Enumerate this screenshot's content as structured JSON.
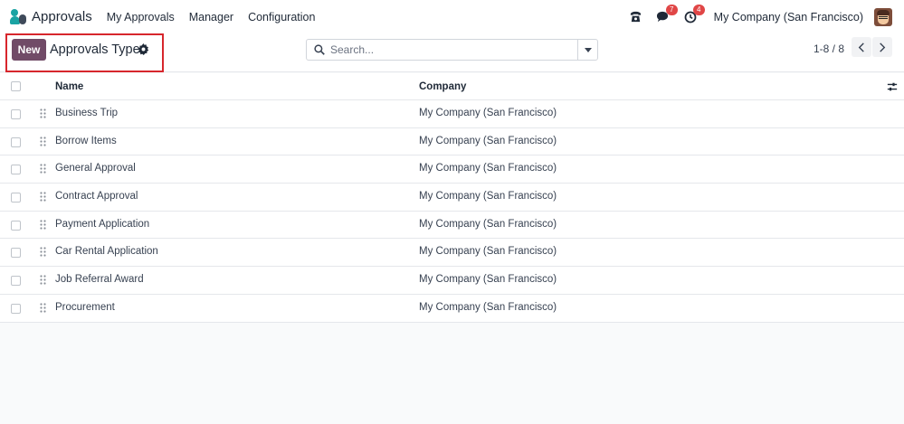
{
  "navbar": {
    "app_title": "Approvals",
    "menu": [
      "My Approvals",
      "Manager",
      "Configuration"
    ],
    "messages_badge": "7",
    "activities_badge": "4",
    "company": "My Company (San Francisco)"
  },
  "control_panel": {
    "new_label": "New",
    "title": "Approvals Types",
    "search_placeholder": "Search...",
    "pager": "1-8 / 8"
  },
  "list": {
    "columns": [
      "Name",
      "Company"
    ],
    "rows": [
      {
        "name": "Business Trip",
        "company": "My Company (San Francisco)"
      },
      {
        "name": "Borrow Items",
        "company": "My Company (San Francisco)"
      },
      {
        "name": "General Approval",
        "company": "My Company (San Francisco)"
      },
      {
        "name": "Contract Approval",
        "company": "My Company (San Francisco)"
      },
      {
        "name": "Payment Application",
        "company": "My Company (San Francisco)"
      },
      {
        "name": "Car Rental Application",
        "company": "My Company (San Francisco)"
      },
      {
        "name": "Job Referral Award",
        "company": "My Company (San Francisco)"
      },
      {
        "name": "Procurement",
        "company": "My Company (San Francisco)"
      }
    ]
  },
  "colors": {
    "primary": "#714b67",
    "highlight_border": "#d7262c",
    "badge": "#e04646",
    "brand_teal": "#1aa3a3"
  }
}
